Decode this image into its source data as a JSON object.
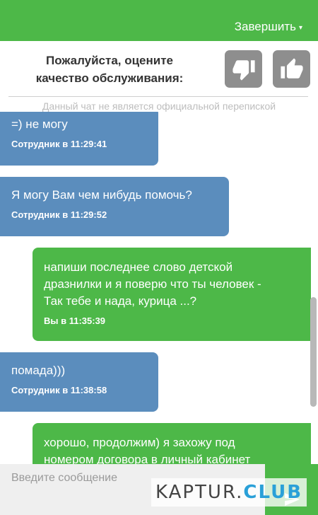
{
  "header": {
    "finish_label": "Завершить",
    "caret": "▾"
  },
  "rating": {
    "prompt_line1": "Пожалуйста, оцените",
    "prompt_line2": "качество обслуживания:",
    "thumbs_down_icon": "thumbs-down-icon",
    "thumbs_up_icon": "thumbs-up-icon"
  },
  "disclaimer": "Данный чат не является официальной перепиской",
  "messages": [
    {
      "sender": "staff",
      "text": "=) не могу",
      "meta": "Сотрудник в 11:29:41"
    },
    {
      "sender": "staff",
      "text": "Я могу Вам чем нибудь помочь?",
      "meta": "Сотрудник в 11:29:52"
    },
    {
      "sender": "me",
      "text_lines": [
        "напиши последнее слово детской",
        "дразнилки и я поверю что ты человек -",
        "Так тебе и нада, курица ...?"
      ],
      "meta": "Вы в 11:35:39"
    },
    {
      "sender": "staff",
      "text": "помада)))",
      "meta": "Сотрудник в 11:38:58"
    },
    {
      "sender": "me",
      "text_lines": [
        "хорошо, продолжим) я захожу под",
        "номером договора в личный кабинет"
      ]
    }
  ],
  "composer": {
    "placeholder": "Введите сообщение"
  },
  "watermark": {
    "part1": "KAPTUR.",
    "part2": "CLUB"
  },
  "colors": {
    "green": "#4db848",
    "staff_bubble": "#5b8dbd",
    "icon_gray": "#8e8e8e"
  }
}
